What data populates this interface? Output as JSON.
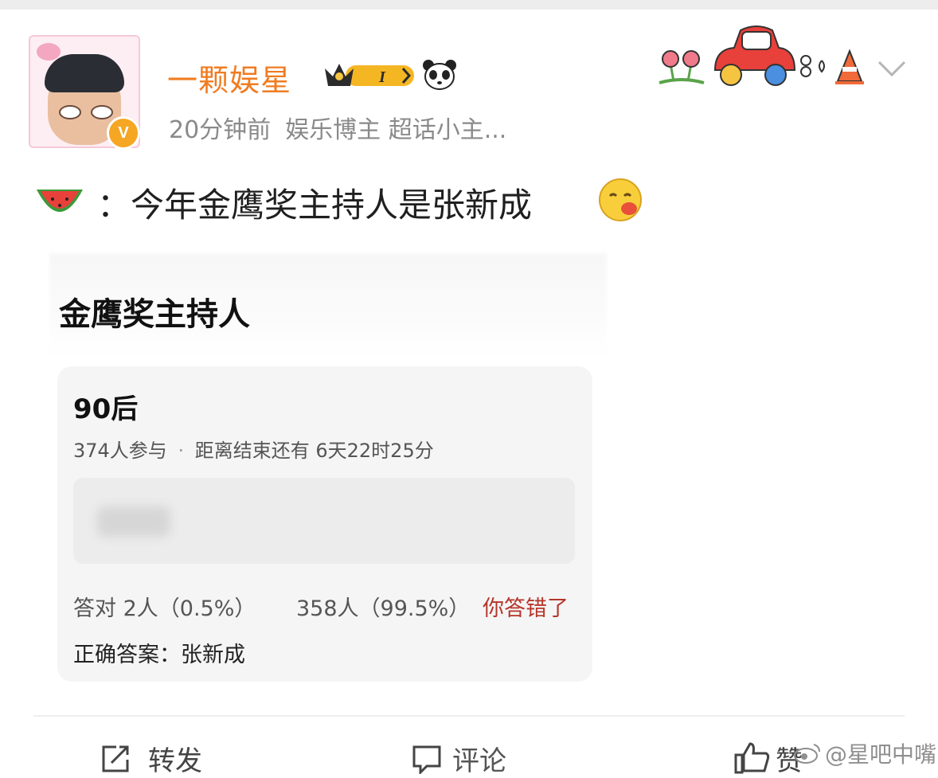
{
  "header": {
    "username": "一颗娱星",
    "vip_level": "I",
    "meta_time": "20分钟前",
    "meta_tags": "娱乐博主 超话小主..."
  },
  "post": {
    "text": "：今年金鹰奖主持人是张新成"
  },
  "quiz": {
    "title": "金鹰奖主持人",
    "heading": "90后",
    "participants": "374人参与",
    "separator": "·",
    "deadline": "距离结束还有 6天22时25分",
    "correct_stat": "答对 2人（0.5%）",
    "wrong_stat": "358人（99.5%）",
    "verdict": "你答错了",
    "correct_answer": "正确答案：张新成"
  },
  "footer": {
    "repost_label": "转发",
    "comment_label": "评论",
    "like_label": "赞",
    "watermark": "@星吧中嘴"
  },
  "colors": {
    "username": "#f07c22",
    "verdict": "#b5352a",
    "meta": "#8a8a8a",
    "card_bg": "#f5f5f5"
  },
  "icons": [
    "verified-icon",
    "vip-crown-icon",
    "panda-icon",
    "flower-icon",
    "car-icon",
    "traffic-cone-icon",
    "chevron-down-icon",
    "watermelon-icon",
    "emoji-icon",
    "share-icon",
    "comment-icon",
    "thumb-up-icon",
    "weibo-logo-icon"
  ]
}
